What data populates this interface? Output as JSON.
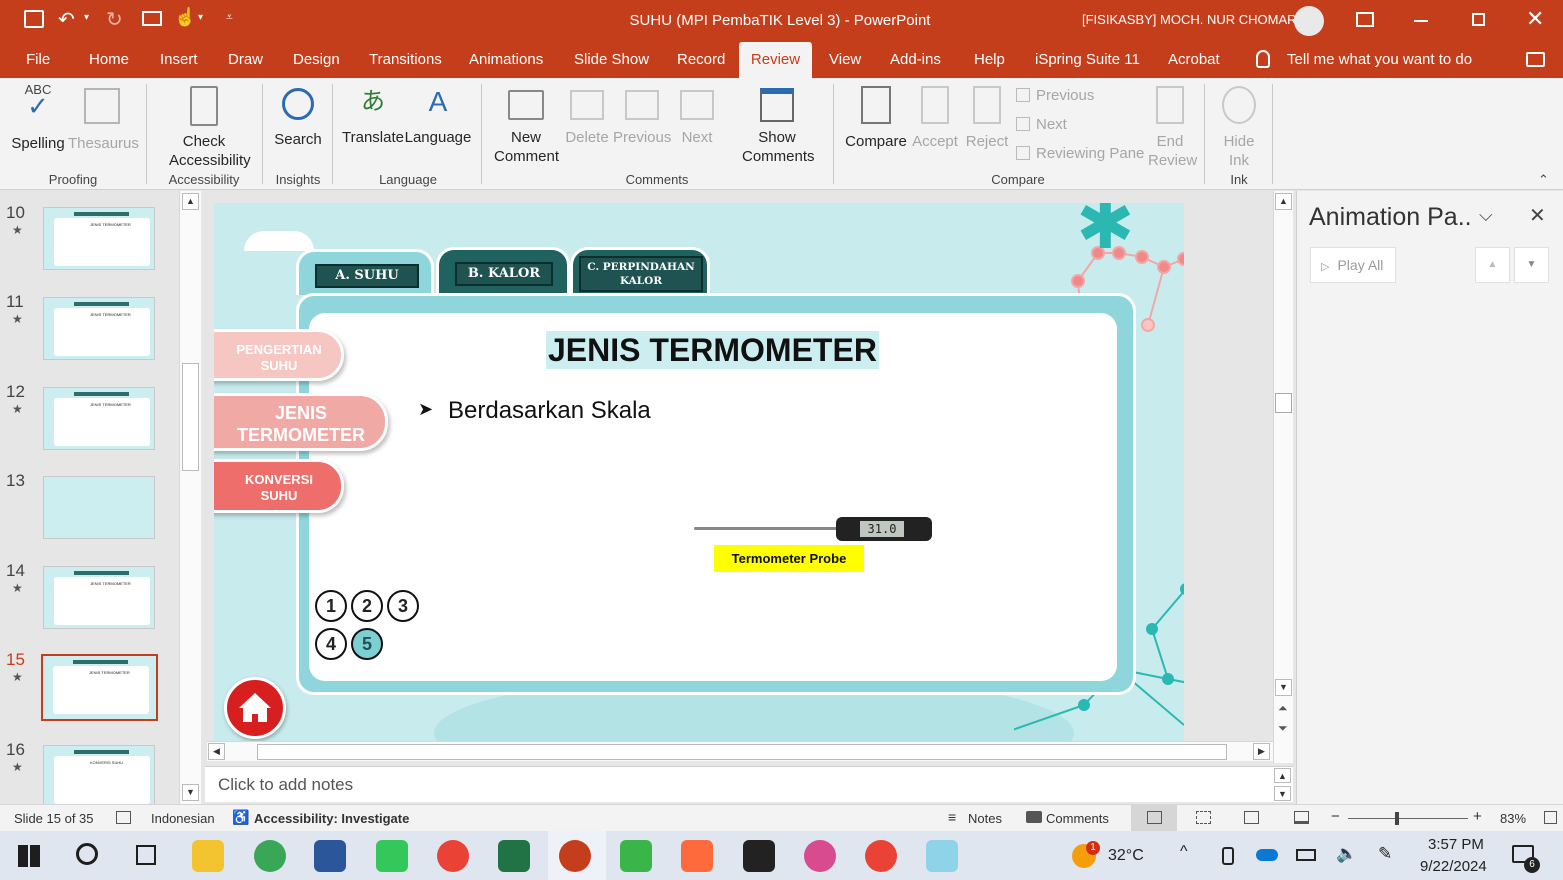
{
  "app": {
    "title": "SUHU (MPI PembaTIK Level 3)  -  PowerPoint",
    "user": "[FISIKASBY] MOCH. NUR CHOMARI"
  },
  "tabs": [
    "File",
    "Home",
    "Insert",
    "Draw",
    "Design",
    "Transitions",
    "Animations",
    "Slide Show",
    "Record",
    "Review",
    "View",
    "Add-ins",
    "Help",
    "iSpring Suite 11",
    "Acrobat"
  ],
  "active_tab": "Review",
  "tell_me": "Tell me what you want to do",
  "ribbon": {
    "spelling": "Spelling",
    "thesaurus": "Thesaurus",
    "check_accessibility": "Check Accessibility",
    "search": "Search",
    "translate": "Translate",
    "language": "Language",
    "new_comment": "New Comment",
    "delete": "Delete",
    "previous": "Previous",
    "next": "Next",
    "show_comments": "Show Comments",
    "compare": "Compare",
    "accept": "Accept",
    "reject": "Reject",
    "cmp_previous": "Previous",
    "cmp_next": "Next",
    "reviewing_pane": "Reviewing Pane",
    "end_review": "End Review",
    "hide_ink": "Hide Ink",
    "groups": {
      "proofing": "Proofing",
      "accessibility": "Accessibility",
      "insights": "Insights",
      "language": "Language",
      "comments": "Comments",
      "compare": "Compare",
      "ink": "Ink"
    }
  },
  "thumbnails": [
    {
      "num": "10",
      "title": "JENIS TERMOMETER"
    },
    {
      "num": "11",
      "title": "JENIS TERMOMETER"
    },
    {
      "num": "12",
      "title": "JENIS TERMOMETER"
    },
    {
      "num": "13",
      "title": ""
    },
    {
      "num": "14",
      "title": "JENIS TERMOMETER"
    },
    {
      "num": "15",
      "title": "JENIS TERMOMETER"
    },
    {
      "num": "16",
      "title": "KONVERSI SUHU"
    }
  ],
  "slide": {
    "tab_a": "A. SUHU",
    "tab_b": "B. KALOR",
    "tab_c": "C. PERPINDAHAN KALOR",
    "side_1": "PENGERTIAN SUHU",
    "side_2": "JENIS TERMOMETER",
    "side_3": "KONVERSI SUHU",
    "title": "JENIS TERMOMETER",
    "bullet": "Berdasarkan Skala",
    "thermo_display": "31.0",
    "thermo_label": "Termometer Probe",
    "nav": [
      "1",
      "2",
      "3",
      "4",
      "5"
    ],
    "active_nav": "5"
  },
  "notes_placeholder": "Click to add notes",
  "animation_pane": {
    "title": "Animation Pa..",
    "play_all": "Play All"
  },
  "status": {
    "slide": "Slide 15 of 35",
    "language": "Indonesian",
    "accessibility": "Accessibility: Investigate",
    "notes": "Notes",
    "comments": "Comments",
    "zoom": "83%"
  },
  "taskbar": {
    "weather": "32°C",
    "weather_badge": "1",
    "time": "3:57 PM",
    "date": "9/22/2024",
    "notif": "6"
  },
  "colors": {
    "accent": "#c43e1c",
    "slide_bg": "#c8ecee",
    "teal_frame": "#8ed6db",
    "tab_dark": "#1f5352",
    "pink": "#f0a9a5"
  }
}
